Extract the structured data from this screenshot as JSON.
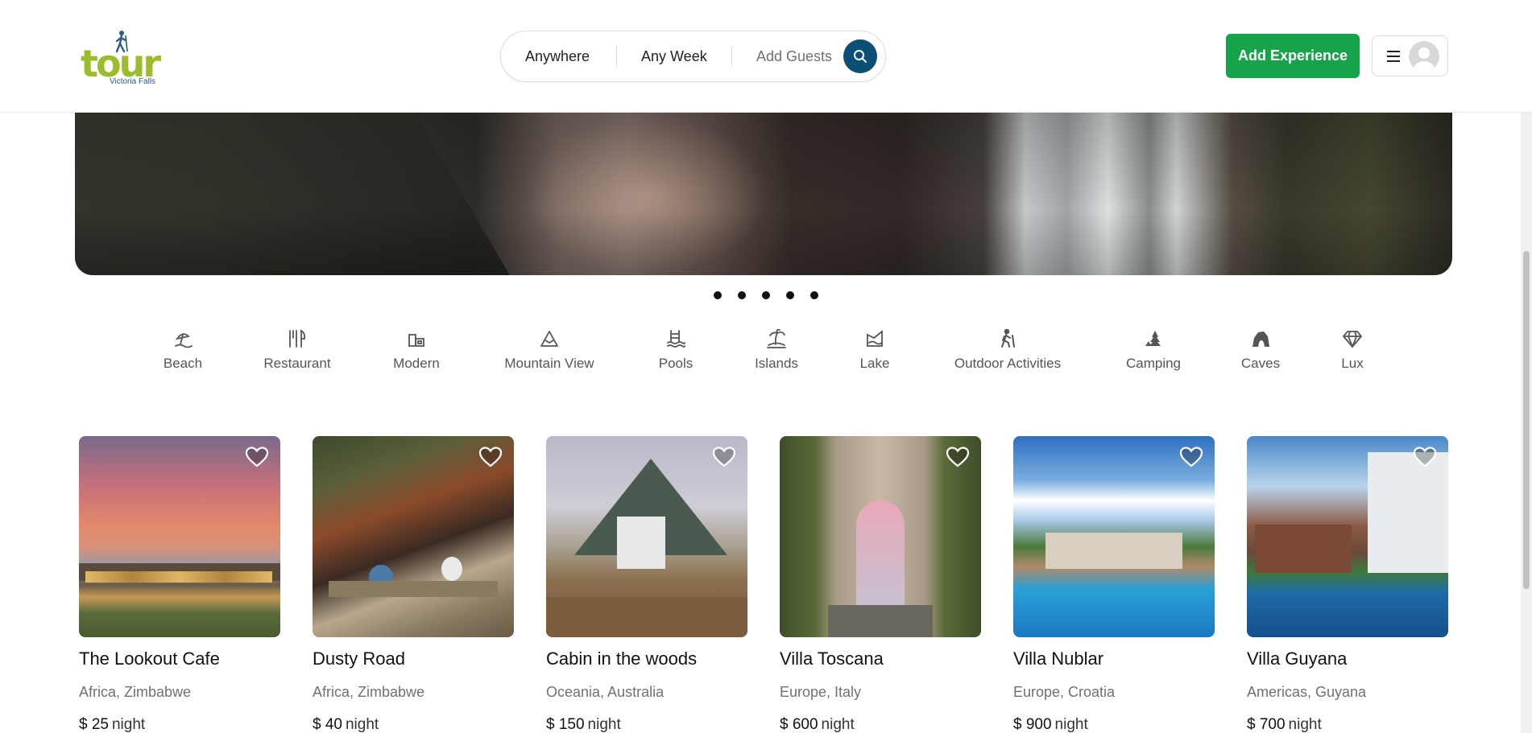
{
  "header": {
    "logo": {
      "text": "tour",
      "subtitle": "Victoria Falls"
    },
    "search": {
      "location": "Anywhere",
      "week": "Any Week",
      "guests": "Add Guests"
    },
    "add_experience": "Add Experience"
  },
  "carousel": {
    "slide_count": 5
  },
  "categories": [
    {
      "label": "Beach",
      "icon": "beach-icon"
    },
    {
      "label": "Restaurant",
      "icon": "restaurant-icon"
    },
    {
      "label": "Modern",
      "icon": "modern-icon"
    },
    {
      "label": "Mountain View",
      "icon": "mountain-view-icon"
    },
    {
      "label": "Pools",
      "icon": "pools-icon"
    },
    {
      "label": "Islands",
      "icon": "islands-icon"
    },
    {
      "label": "Lake",
      "icon": "lake-icon"
    },
    {
      "label": "Outdoor Activities",
      "icon": "outdoor-activities-icon"
    },
    {
      "label": "Camping",
      "icon": "camping-icon"
    },
    {
      "label": "Caves",
      "icon": "caves-icon"
    },
    {
      "label": "Lux",
      "icon": "lux-icon"
    }
  ],
  "listings": [
    {
      "title": "The Lookout Cafe",
      "location": "Africa, Zimbabwe",
      "price": "$ 25",
      "unit": "night"
    },
    {
      "title": "Dusty Road",
      "location": "Africa, Zimbabwe",
      "price": "$ 40",
      "unit": "night"
    },
    {
      "title": "Cabin in the woods",
      "location": "Oceania, Australia",
      "price": "$ 150",
      "unit": "night"
    },
    {
      "title": "Villa Toscana",
      "location": "Europe, Italy",
      "price": "$ 600",
      "unit": "night"
    },
    {
      "title": "Villa Nublar",
      "location": "Europe, Croatia",
      "price": "$ 900",
      "unit": "night"
    },
    {
      "title": "Villa Guyana",
      "location": "Americas, Guyana",
      "price": "$ 700",
      "unit": "night"
    }
  ],
  "colors": {
    "brand_green": "#16a34a",
    "search_button": "#0b4f74",
    "logo_green": "#9bbd2b"
  }
}
